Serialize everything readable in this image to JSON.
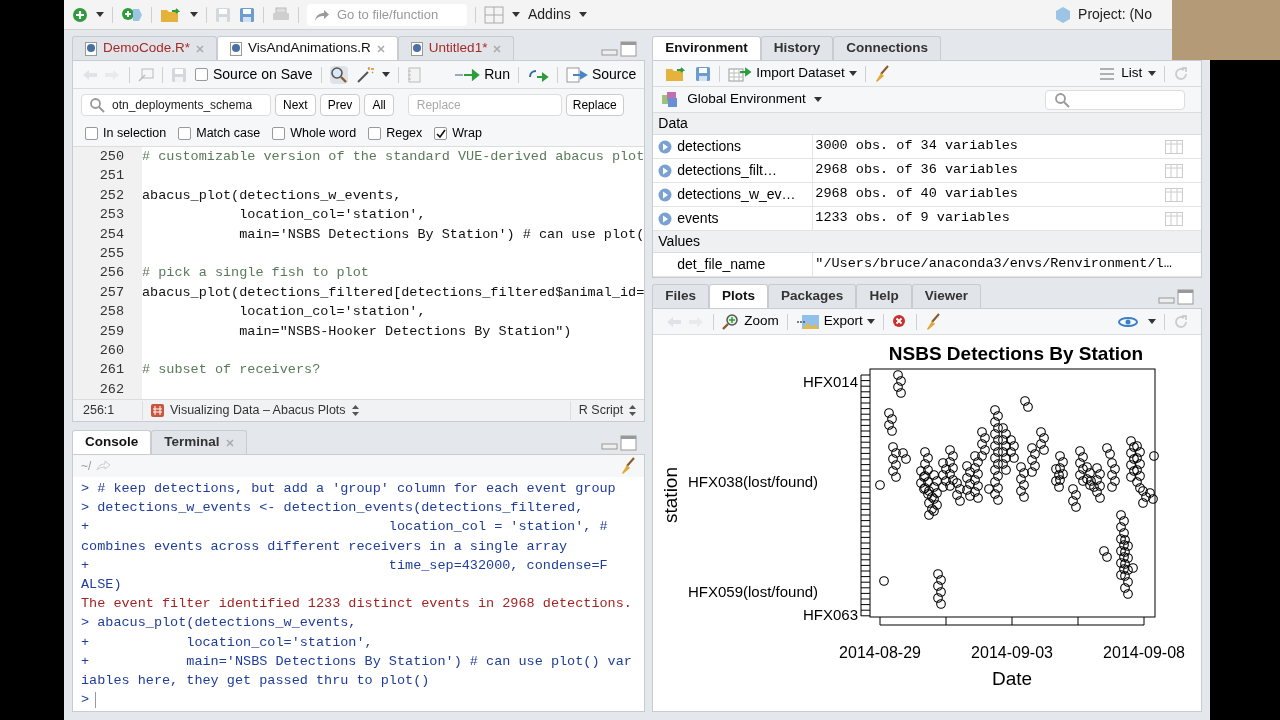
{
  "toolbar": {
    "goto_placeholder": "Go to file/function",
    "addins": "Addins",
    "project": "Project: (No"
  },
  "editor": {
    "tabs": [
      {
        "label": "DemoCode.R*",
        "selected": false,
        "modified": true
      },
      {
        "label": "VisAndAnimations.R",
        "selected": true,
        "modified": false
      },
      {
        "label": "Untitled1*",
        "selected": false,
        "modified": true
      }
    ],
    "source_on_save": {
      "label": "Source on Save",
      "checked": false
    },
    "run": "Run",
    "source": "Source",
    "find": {
      "value": "otn_deployments_schema",
      "buttons": [
        "Next",
        "Prev",
        "All"
      ],
      "replace_placeholder": "Replace",
      "replace_button": "Replace"
    },
    "options": [
      {
        "label": "In selection",
        "checked": false
      },
      {
        "label": "Match case",
        "checked": false
      },
      {
        "label": "Whole word",
        "checked": false
      },
      {
        "label": "Regex",
        "checked": false
      },
      {
        "label": "Wrap",
        "checked": true
      }
    ],
    "lines": [
      {
        "number": "250",
        "kind": "comment",
        "text": "# customizable version of the standard VUE-derived abacus plot"
      },
      {
        "number": "251"
      },
      {
        "number": "252",
        "kind": "code",
        "text": "abacus_plot(detections_w_events,"
      },
      {
        "number": "253",
        "kind": "code",
        "text": "            location_col='station',"
      },
      {
        "number": "254",
        "kind": "code",
        "text": "            main='NSBS Detections By Station') # can use plot("
      },
      {
        "number": "255"
      },
      {
        "number": "256",
        "kind": "comment",
        "text": "# pick a single fish to plot"
      },
      {
        "number": "257",
        "kind": "code",
        "text": "abacus_plot(detections_filtered[detections_filtered$animal_id="
      },
      {
        "number": "258",
        "kind": "code",
        "text": "            location_col='station',"
      },
      {
        "number": "259",
        "kind": "code",
        "text": "            main=\"NSBS-Hooker Detections By Station\")"
      },
      {
        "number": "260"
      },
      {
        "number": "261",
        "kind": "comment",
        "text": "# subset of receivers?"
      },
      {
        "number": "262"
      }
    ],
    "status": {
      "position": "256:1",
      "section": "Visualizing Data – Abacus Plots",
      "filetype": "R Script"
    }
  },
  "console": {
    "tabs": [
      {
        "label": "Console",
        "selected": true
      },
      {
        "label": "Terminal",
        "selected": false
      }
    ],
    "path": "~/",
    "lines": [
      {
        "kind": "input",
        "text": "> # keep detections, but add a 'group' column for each event group"
      },
      {
        "kind": "input",
        "text": "> detections_w_events <- detection_events(detections_filtered,"
      },
      {
        "kind": "input",
        "text": "+                                     location_col = 'station', #"
      },
      {
        "kind": "input",
        "text": "combines events across different receivers in a single array"
      },
      {
        "kind": "input",
        "text": "+                                     time_sep=432000, condense=F"
      },
      {
        "kind": "input",
        "text": "ALSE)"
      },
      {
        "kind": "message",
        "text": "The event filter identified 1233 distinct events in 2968 detections."
      },
      {
        "kind": "input",
        "text": "> abacus_plot(detections_w_events,"
      },
      {
        "kind": "input",
        "text": "+            location_col='station',"
      },
      {
        "kind": "input",
        "text": "+            main='NSBS Detections By Station') # can use plot() var"
      },
      {
        "kind": "input",
        "text": "iables here, they get passed thru to plot()"
      },
      {
        "kind": "prompt",
        "text": ">"
      }
    ]
  },
  "environment": {
    "tabs": [
      {
        "label": "Environment",
        "selected": true
      },
      {
        "label": "History",
        "selected": false
      },
      {
        "label": "Connections",
        "selected": false
      }
    ],
    "import": "Import Dataset",
    "view": "List",
    "scope": "Global Environment",
    "sections": [
      {
        "title": "Data",
        "rows": [
          {
            "kind": "data",
            "name": "detections",
            "value": "3000 obs. of 34 variables"
          },
          {
            "kind": "data",
            "name": "detections_filt…",
            "value": "2968 obs. of 36 variables"
          },
          {
            "kind": "data",
            "name": "detections_w_ev…",
            "value": "2968 obs. of 40 variables"
          },
          {
            "kind": "data",
            "name": "events",
            "value": "1233 obs. of 9 variables"
          }
        ]
      },
      {
        "title": "Values",
        "rows": [
          {
            "kind": "value",
            "name": "det_file_name",
            "value": "\"/Users/bruce/anaconda3/envs/Renvironment/l…"
          }
        ]
      }
    ]
  },
  "files": {
    "tabs": [
      {
        "label": "Files",
        "selected": false
      },
      {
        "label": "Plots",
        "selected": true
      },
      {
        "label": "Packages",
        "selected": false
      },
      {
        "label": "Help",
        "selected": false
      },
      {
        "label": "Viewer",
        "selected": false
      }
    ],
    "zoom": "Zoom",
    "export": "Export",
    "plot": {
      "title": "NSBS Detections By Station",
      "xlabel": "Date",
      "ylabel": "station",
      "xtick_labels": [
        "2014-08-29",
        "2014-09-03",
        "2014-09-08"
      ],
      "ytick_labels": [
        "HFX014",
        "HFX038(lost/found)",
        "HFX059(lost/found)",
        "HFX063"
      ]
    }
  }
}
